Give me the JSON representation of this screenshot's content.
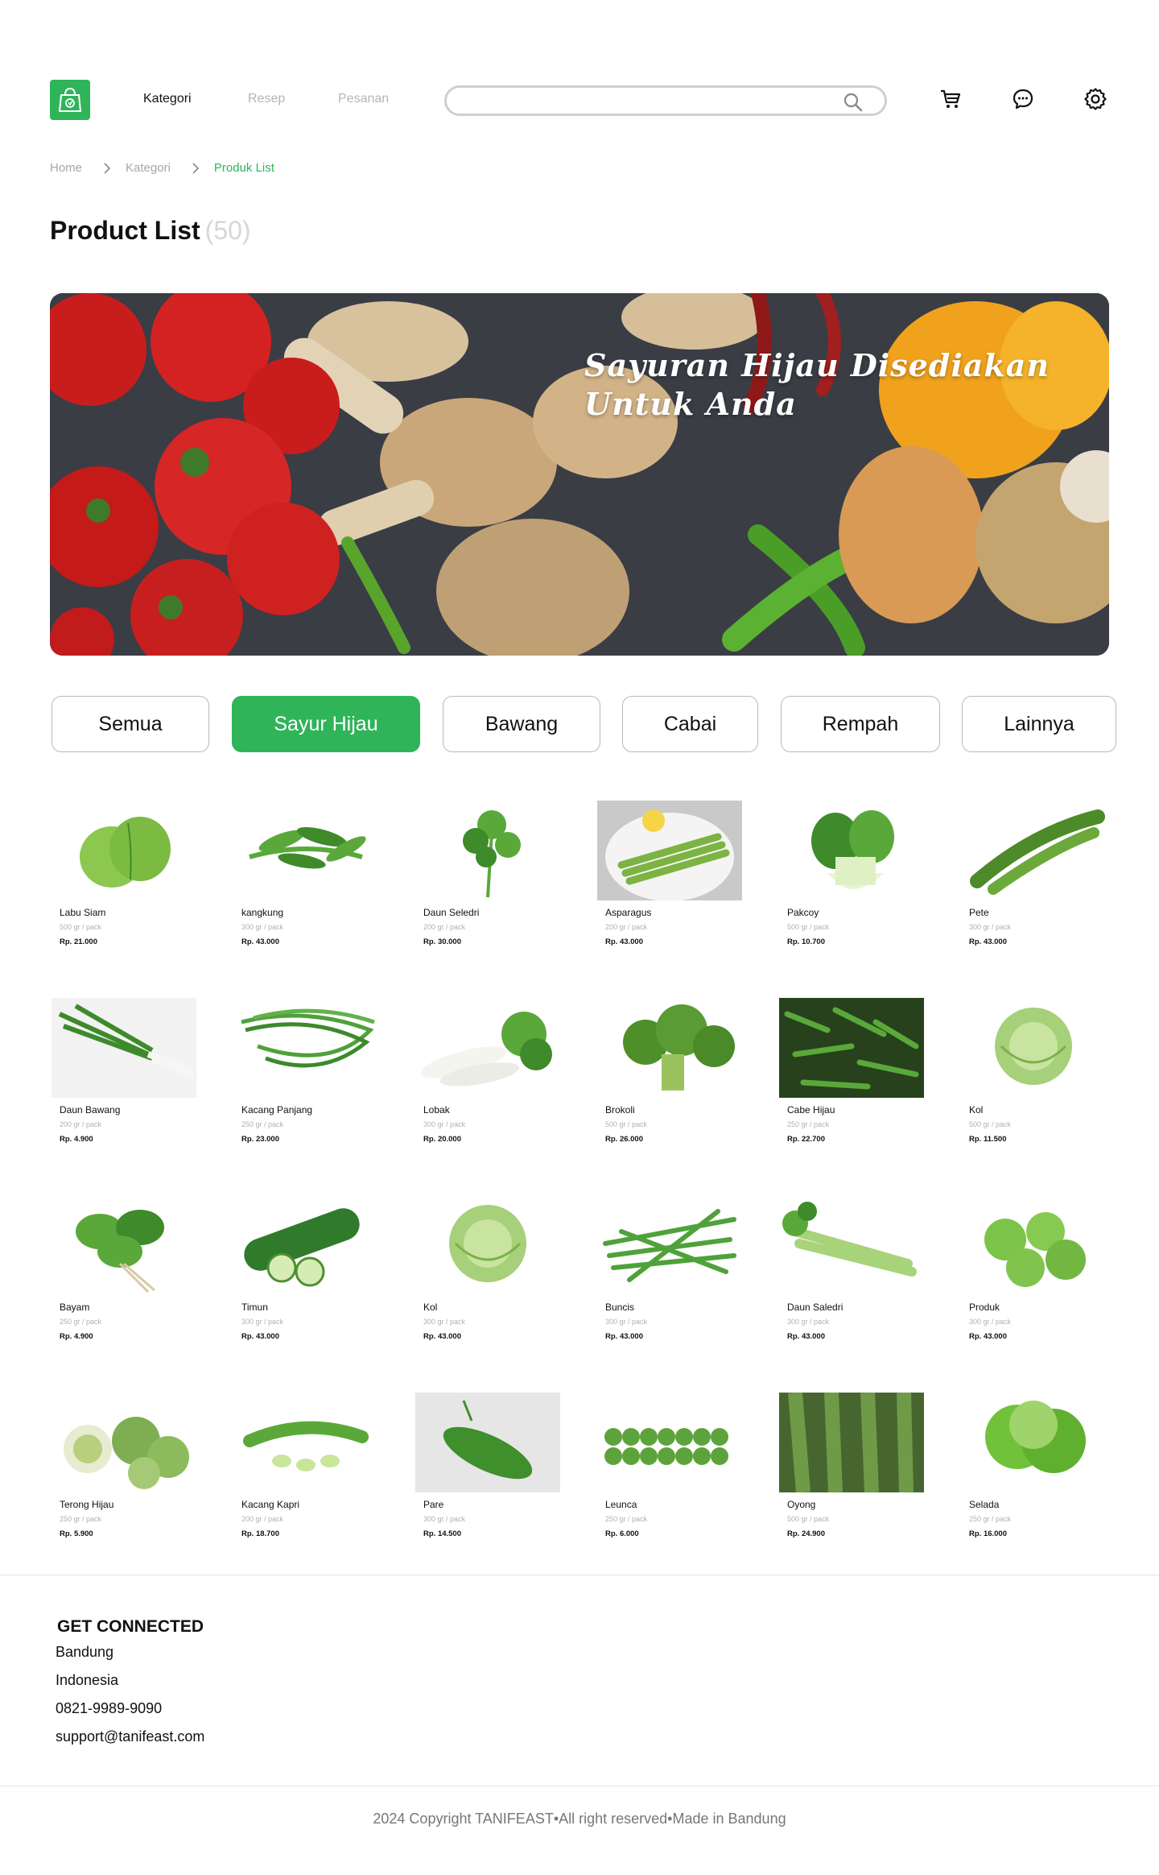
{
  "header": {
    "nav": [
      "Kategori",
      "Resep",
      "Pesanan"
    ],
    "search_placeholder": ""
  },
  "breadcrumb": [
    "Home",
    "Kategori",
    "Produk List"
  ],
  "page": {
    "title": "Product List",
    "count": "(50)"
  },
  "banner": {
    "line1": "Sayuran Hijau Disediakan",
    "line2": "Untuk Anda"
  },
  "tabs": [
    "Semua",
    "Sayur Hijau",
    "Bawang",
    "Cabai",
    "Rempah",
    "Lainnya"
  ],
  "active_tab": "Sayur Hijau",
  "products": [
    {
      "name": "Labu Siam",
      "unit": "500 gr / pack",
      "price": "Rp. 21.000",
      "icon": "chayote-image"
    },
    {
      "name": "kangkung",
      "unit": "300 gr / pack",
      "price": "Rp. 43.000",
      "icon": "water-spinach-image"
    },
    {
      "name": "Daun Seledri",
      "unit": "200 gr / pack",
      "price": "Rp. 30.000",
      "icon": "celery-leaf-image"
    },
    {
      "name": "Asparagus",
      "unit": "200 gr / pack",
      "price": "Rp. 43.000",
      "icon": "asparagus-image"
    },
    {
      "name": "Pakcoy",
      "unit": "500 gr / pack",
      "price": "Rp. 10.700",
      "icon": "bok-choy-image"
    },
    {
      "name": "Pete",
      "unit": "300 gr / pack",
      "price": "Rp. 43.000",
      "icon": "stink-bean-image"
    },
    {
      "name": "Daun Bawang",
      "unit": "200 gr / pack",
      "price": "Rp. 4.900",
      "icon": "scallion-image"
    },
    {
      "name": "Kacang Panjang",
      "unit": "250 gr / pack",
      "price": "Rp. 23.000",
      "icon": "long-bean-image"
    },
    {
      "name": "Lobak",
      "unit": "300 gr / pack",
      "price": "Rp. 20.000",
      "icon": "radish-image"
    },
    {
      "name": "Brokoli",
      "unit": "500 gr / pack",
      "price": "Rp. 26.000",
      "icon": "broccoli-image"
    },
    {
      "name": "Cabe Hijau",
      "unit": "250 gr / pack",
      "price": "Rp. 22.700",
      "icon": "green-chili-image"
    },
    {
      "name": "Kol",
      "unit": "500 gr / pack",
      "price": "Rp. 11.500",
      "icon": "cabbage-image"
    },
    {
      "name": "Bayam",
      "unit": "250 gr / pack",
      "price": "Rp. 4.900",
      "icon": "spinach-image"
    },
    {
      "name": "Timun",
      "unit": "300 gr / pack",
      "price": "Rp. 43.000",
      "icon": "cucumber-image"
    },
    {
      "name": "Kol",
      "unit": "300 gr / pack",
      "price": "Rp. 43.000",
      "icon": "cabbage-image"
    },
    {
      "name": "Buncis",
      "unit": "300 gr / pack",
      "price": "Rp. 43.000",
      "icon": "green-bean-image"
    },
    {
      "name": "Daun Saledri",
      "unit": "300 gr / pack",
      "price": "Rp. 43.000",
      "icon": "celery-stalk-image"
    },
    {
      "name": "Produk",
      "unit": "300 gr / pack",
      "price": "Rp. 43.000",
      "icon": "green-tomato-image"
    },
    {
      "name": "Terong Hijau",
      "unit": "250 gr / pack",
      "price": "Rp. 5.900",
      "icon": "green-eggplant-image"
    },
    {
      "name": "Kacang Kapri",
      "unit": "200 gr / pack",
      "price": "Rp. 18.700",
      "icon": "snow-pea-image"
    },
    {
      "name": "Pare",
      "unit": "300 gr / pack",
      "price": "Rp. 14.500",
      "icon": "bitter-melon-image"
    },
    {
      "name": "Leunca",
      "unit": "250 gr / pack",
      "price": "Rp. 6.000",
      "icon": "leunca-image"
    },
    {
      "name": "Oyong",
      "unit": "500 gr / pack",
      "price": "Rp. 24.900",
      "icon": "luffa-image"
    },
    {
      "name": "Selada",
      "unit": "250 gr / pack",
      "price": "Rp. 16.000",
      "icon": "lettuce-image"
    }
  ],
  "footer": {
    "title": "GET CONNECTED",
    "lines": [
      "Bandung",
      "Indonesia",
      "0821-9989-9090",
      "support@tanifeast.com"
    ],
    "copyright": "2024 Copyright TANIFEAST•All right reserved•Made in Bandung"
  },
  "colors": {
    "accent": "#2fb45a",
    "muted": "#b5b5b5",
    "border": "#b9b9b9"
  }
}
